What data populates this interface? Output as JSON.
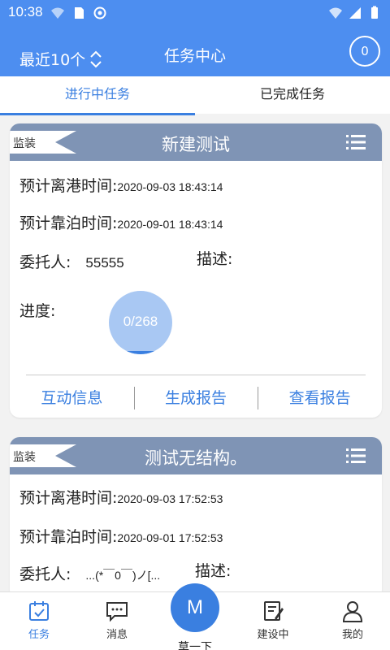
{
  "status_bar": {
    "time": "10:38",
    "icons_left": [
      "wifi-question-icon",
      "sd-card-icon",
      "sync-icon"
    ],
    "icons_right": [
      "wifi-icon",
      "signal-icon",
      "battery-icon"
    ]
  },
  "header": {
    "filter_label": "最近10个",
    "title": "任务中心",
    "count": "0"
  },
  "tabs": [
    {
      "label": "进行中任务",
      "active": true
    },
    {
      "label": "已完成任务",
      "active": false
    }
  ],
  "tasks": [
    {
      "tag": "监装",
      "title": "新建测试",
      "depart_label": "预计离港时间:",
      "depart_time": "2020-09-03 18:43:14",
      "berth_label": "预计靠泊时间:",
      "berth_time": "2020-09-01 18:43:14",
      "client_label": "委托人:",
      "client": "55555",
      "desc_label": "描述:",
      "progress_label": "进度:",
      "progress_text": "0/268",
      "progress_fraction": 0.0,
      "actions": [
        "互动信息",
        "生成报告",
        "查看报告"
      ]
    },
    {
      "tag": "监装",
      "title": "测试无结构。",
      "depart_label": "预计离港时间:",
      "depart_time": "2020-09-03 17:52:53",
      "berth_label": "预计靠泊时间:",
      "berth_time": "2020-09-01 17:52:53",
      "client_label": "委托人:",
      "client": "...(*￣0￣)ノ[...",
      "desc_label": "描述:"
    }
  ],
  "bottom_nav": {
    "items": [
      {
        "label": "任务",
        "icon": "task-calendar-icon",
        "active": true
      },
      {
        "label": "消息",
        "icon": "message-icon",
        "active": false
      },
      {
        "label": "建设中",
        "icon": "edit-doc-icon",
        "active": false
      },
      {
        "label": "我的",
        "icon": "user-icon",
        "active": false
      }
    ],
    "center": {
      "letter": "M",
      "label": "草一下"
    }
  },
  "colors": {
    "primary": "#4d8ef0",
    "accent": "#3a7fe0",
    "card_header": "#7f94b5",
    "background": "#f2f2f2"
  }
}
